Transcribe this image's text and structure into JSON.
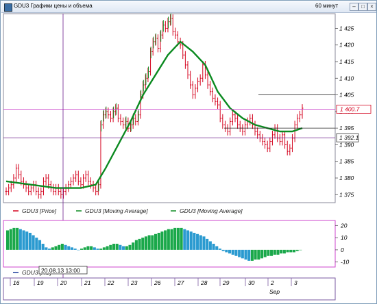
{
  "window": {
    "title": "GDU3 Графики цены и объема",
    "period": "60 минут",
    "btn_min": "–",
    "btn_max": "□",
    "btn_close": "×"
  },
  "colors": {
    "price": "#d4001c",
    "ma_fast": "#0b8a20",
    "ma_slow": "#1a7a3a",
    "histogram": "#1aa84a",
    "histogram_neg": "#2a9ad0",
    "crosshair": "#6a1a8a",
    "hline": "#cc44cc"
  },
  "chart_data": [
    {
      "type": "line",
      "title": "",
      "y_ticks": [
        "1 375",
        "1 380",
        "1 385",
        "1 390",
        "1 395",
        "1 400",
        "1 405",
        "1 410",
        "1 415",
        "1 420",
        "1 425"
      ],
      "ylim": [
        1373,
        1429
      ],
      "price_label": "1 400.7",
      "cross_price_label": "1 392.1",
      "reference_price": 1395,
      "x_labels": [
        "16",
        "19",
        "20",
        "21",
        "22",
        "23",
        "26",
        "27",
        "28",
        "29",
        "30",
        "2",
        "3"
      ],
      "month_label": "Sep",
      "crosshair_label": "20.08.13 13:00",
      "legend": [
        {
          "name": "GDU3 [Price]"
        },
        {
          "name": "GDU3 [Moving Average]"
        },
        {
          "name": "GDU3 [Moving Average]"
        }
      ],
      "series": [
        {
          "name": "GDU3 [Price]",
          "x": [
            0,
            1,
            2,
            3,
            4,
            5,
            6,
            7,
            8,
            9,
            10,
            11,
            12,
            13,
            14,
            15,
            16,
            17,
            18,
            19,
            20,
            21,
            22,
            23,
            24,
            25,
            26,
            27,
            28,
            29,
            30,
            31,
            32,
            33,
            34,
            35,
            36,
            37,
            38,
            39,
            40,
            41,
            42,
            43,
            44,
            45,
            46,
            47,
            48,
            49,
            50,
            51,
            52,
            53,
            54,
            55,
            56,
            57,
            58,
            59,
            60,
            61,
            62,
            63,
            64,
            65,
            66,
            67,
            68,
            69,
            70,
            71,
            72,
            73,
            74,
            75,
            76,
            77,
            78,
            79,
            80,
            81,
            82,
            83,
            84,
            85,
            86,
            87,
            88,
            89,
            90,
            91,
            92,
            93,
            94,
            95,
            96,
            97,
            98,
            99,
            100,
            101,
            102,
            103,
            104,
            105,
            106,
            107,
            108,
            109,
            110,
            111,
            112,
            113,
            114,
            115,
            116,
            117,
            118,
            119
          ],
          "values": [
            1376,
            1377,
            1378,
            1380,
            1383,
            1381,
            1379,
            1378,
            1377,
            1376,
            1377,
            1378,
            1376,
            1375,
            1376,
            1379,
            1380,
            1378,
            1377,
            1376,
            1377,
            1376,
            1375,
            1376,
            1377,
            1378,
            1379,
            1380,
            1381,
            1379,
            1378,
            1380,
            1381,
            1379,
            1378,
            1377,
            1376,
            1378,
            1396,
            1399,
            1400,
            1399,
            1398,
            1400,
            1401,
            1398,
            1397,
            1396,
            1397,
            1395,
            1396,
            1398,
            1397,
            1399,
            1405,
            1408,
            1410,
            1412,
            1418,
            1421,
            1422,
            1419,
            1423,
            1426,
            1425,
            1427,
            1428,
            1424,
            1423,
            1421,
            1420,
            1417,
            1414,
            1411,
            1408,
            1405,
            1407,
            1409,
            1410,
            1414,
            1411,
            1408,
            1406,
            1404,
            1403,
            1402,
            1398,
            1396,
            1395,
            1394,
            1397,
            1399,
            1398,
            1396,
            1395,
            1394,
            1396,
            1397,
            1398,
            1396,
            1394,
            1393,
            1392,
            1391,
            1390,
            1389,
            1391,
            1393,
            1395,
            1392,
            1391,
            1393,
            1390,
            1388,
            1389,
            1392,
            1396,
            1398,
            1399,
            1401
          ]
        },
        {
          "name": "GDU3 [Moving Average]",
          "x": [
            0,
            10,
            20,
            30,
            36,
            40,
            45,
            50,
            55,
            60,
            65,
            70,
            75,
            80,
            85,
            90,
            95,
            100,
            105,
            110,
            115,
            119
          ],
          "values": [
            1379,
            1378,
            1377,
            1377,
            1378,
            1383,
            1390,
            1397,
            1405,
            1411,
            1417,
            1421,
            1418,
            1414,
            1406,
            1401,
            1398,
            1396,
            1395,
            1394,
            1394,
            1395
          ]
        }
      ]
    },
    {
      "type": "bar",
      "title": "",
      "y_ticks": [
        "20",
        "10",
        "0",
        "-10"
      ],
      "ylim": [
        -13,
        23
      ],
      "legend": [
        {
          "name": "GDU3 [AO]"
        }
      ],
      "series": [
        {
          "name": "GDU3 [AO]",
          "values": [
            16,
            17,
            18,
            18,
            17,
            16,
            15,
            14,
            12,
            10,
            8,
            5,
            2,
            1,
            2,
            3,
            4,
            5,
            4,
            3,
            2,
            1,
            0,
            1,
            2,
            3,
            3,
            2,
            1,
            1,
            2,
            3,
            4,
            5,
            5,
            4,
            3,
            3,
            4,
            6,
            8,
            9,
            10,
            11,
            12,
            12,
            13,
            14,
            15,
            16,
            17,
            17,
            18,
            18,
            18,
            17,
            16,
            15,
            14,
            13,
            12,
            11,
            9,
            7,
            5,
            3,
            1,
            -1,
            -2,
            -3,
            -4,
            -5,
            -6,
            -7,
            -8,
            -9,
            -9,
            -8,
            -8,
            -7,
            -6,
            -5,
            -5,
            -4,
            -4,
            -3,
            -3,
            -2,
            -2,
            -2,
            -1,
            0
          ]
        }
      ]
    }
  ]
}
